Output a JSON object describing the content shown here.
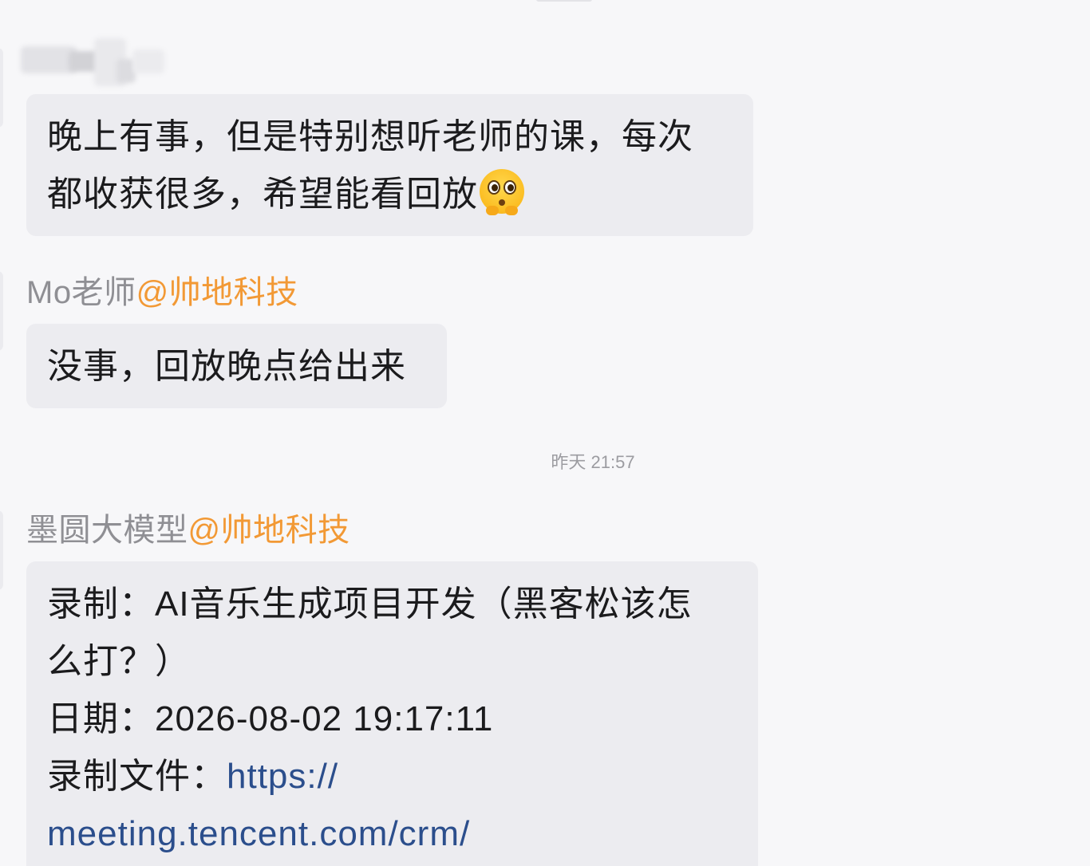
{
  "messages": [
    {
      "sender": "",
      "lines": [
        "晚上有事，但是特别想听老师的课，每次",
        "都收获很多，希望能看回放"
      ],
      "emoji": "pleading-face-icon"
    },
    {
      "sender": "Mo老师",
      "mention": "@帅地科技",
      "lines": [
        "没事，回放晚点给出来"
      ]
    },
    {
      "sender": "墨圆大模型",
      "mention": "@帅地科技",
      "lines": [
        "录制：AI音乐生成项目开发（黑客松该怎",
        "么打？）",
        "日期：2026-08-02 19:17:11"
      ],
      "file_label": "录制文件：",
      "link_part1": "https://",
      "link_part2": "meeting.tencent.com/crm/"
    }
  ],
  "timestamp": "昨天 21:57",
  "colors": {
    "background": "#f7f7f9",
    "bubble": "#ececf0",
    "mention": "#f29935",
    "sender": "#8f8f94",
    "link": "#2b4e8c"
  }
}
